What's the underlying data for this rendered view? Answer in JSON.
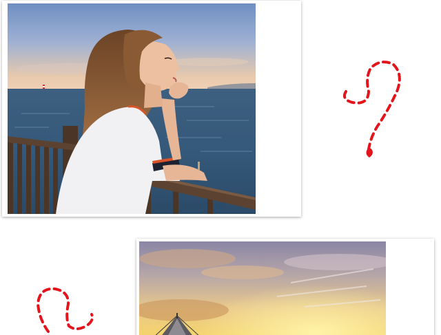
{
  "photos": [
    {
      "icon": "photo-woman-at-seaside-railing",
      "accent": "#2c5f8a"
    },
    {
      "icon": "photo-sunset-sky-with-tent",
      "accent": "#f0c25a"
    }
  ],
  "doodles": [
    {
      "icon": "red-dashed-question-mark-icon",
      "color": "#e3141b"
    },
    {
      "icon": "red-dashed-squiggle-icon",
      "color": "#e3141b"
    }
  ]
}
